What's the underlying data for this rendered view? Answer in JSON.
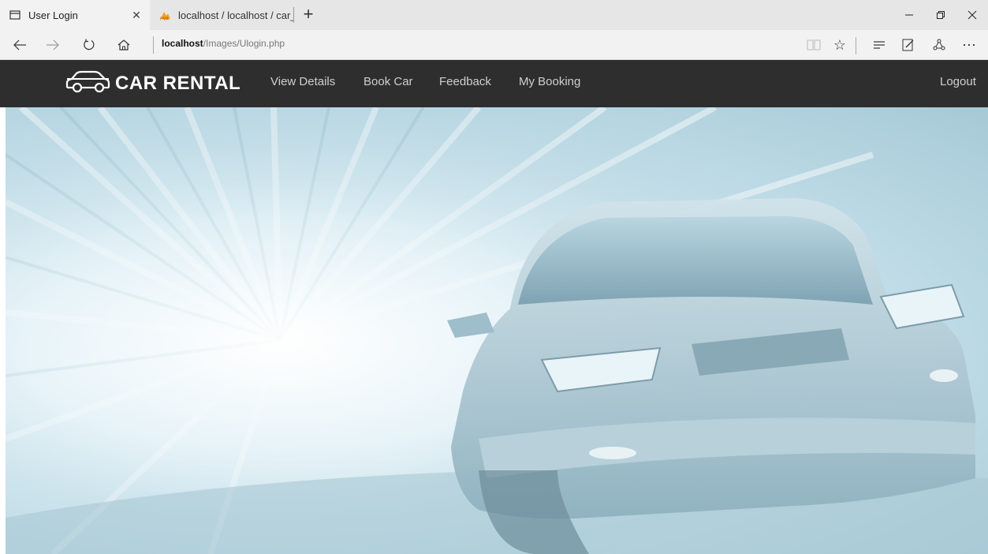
{
  "browser": {
    "tabs": [
      {
        "label": "User Login",
        "active": true
      },
      {
        "label": "localhost / localhost / car_re",
        "active": false
      }
    ],
    "address": {
      "host": "localhost",
      "path": "/Images/Ulogin.php"
    }
  },
  "site": {
    "logo_text": "CAR RENTAL",
    "menu": [
      "View Details",
      "Book Car",
      "Feedback",
      "My Booking"
    ],
    "logout": "Logout"
  },
  "colors": {
    "header_bg": "#2e2e2e",
    "tab_strip": "#e6e6e6",
    "hero_tint": "#b7d6e2"
  }
}
